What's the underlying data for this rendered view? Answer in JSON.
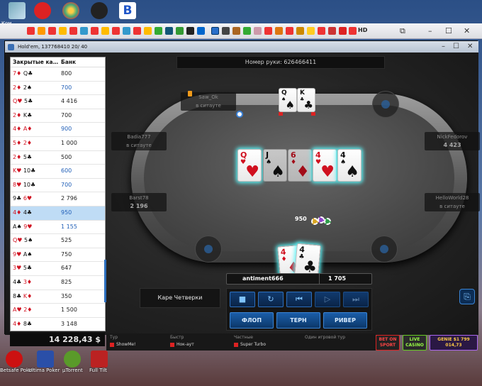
{
  "desktop": {
    "top_label": "Ком",
    "bottom_icons": [
      {
        "label": "Betsafe Poker"
      },
      {
        "label": "Ultima Poker"
      },
      {
        "label": "µTorrent"
      },
      {
        "label": "Full Tilt"
      }
    ]
  },
  "browser": {
    "hd_label": "HD"
  },
  "window": {
    "title": "Hold'em, 137768410  20/ 40"
  },
  "table": {
    "hand_number": "Номер руки: 626466411",
    "pot": "950",
    "board": [
      {
        "rank": "Q",
        "suit": "♥",
        "color": "red",
        "glow": true
      },
      {
        "rank": "J",
        "suit": "♠",
        "color": "black",
        "glow": false
      },
      {
        "rank": "6",
        "suit": "♦",
        "color": "red",
        "glow": false
      },
      {
        "rank": "4",
        "suit": "♥",
        "color": "red",
        "glow": true
      },
      {
        "rank": "4",
        "suit": "♠",
        "color": "black",
        "glow": true
      }
    ],
    "top_player_cards": [
      {
        "rank": "Q",
        "suit": "♠",
        "color": "black"
      },
      {
        "rank": "K",
        "suit": "♣",
        "color": "black"
      }
    ],
    "hero_cards": [
      {
        "rank": "4",
        "suit": "♦",
        "color": "red"
      },
      {
        "rank": "4",
        "suit": "♣",
        "color": "black"
      }
    ],
    "players": [
      {
        "name": "Saw_Ok",
        "status": "в ситауте"
      },
      {
        "name": "Badia777",
        "status": "в ситауте"
      },
      {
        "name": "NickFedorov",
        "stack": "4 423"
      },
      {
        "name": "Barst78",
        "stack": "2 196"
      },
      {
        "name": "HelloWorld28",
        "status": "в ситауте"
      }
    ],
    "hero": {
      "name": "antiment666",
      "stack": "1 705"
    },
    "hand_rank": "Каре Четверки"
  },
  "controls": {
    "icons": [
      "stop-icon",
      "refresh-icon",
      "skip-back-icon",
      "step-forward-icon",
      "skip-forward-icon"
    ],
    "flop": "ФЛОП",
    "turn": "ТЕРН",
    "river": "РИВЕР"
  },
  "history": {
    "col_hand": "Закрытые ка…",
    "col_pot": "Банк",
    "rows": [
      {
        "c1": "7",
        "s1": "♦",
        "c2": "Q",
        "s2": "♣",
        "pot": "800",
        "blue": false
      },
      {
        "c1": "2",
        "s1": "♦",
        "c2": "2",
        "s2": "♠",
        "pot": "700",
        "blue": true
      },
      {
        "c1": "Q",
        "s1": "♥",
        "c2": "5",
        "s2": "♣",
        "pot": "4 416",
        "blue": false
      },
      {
        "c1": "2",
        "s1": "♦",
        "c2": "K",
        "s2": "♣",
        "pot": "700",
        "blue": false
      },
      {
        "c1": "4",
        "s1": "♦",
        "c2": "A",
        "s2": "♦",
        "pot": "900",
        "blue": true
      },
      {
        "c1": "5",
        "s1": "♦",
        "c2": "2",
        "s2": "♦",
        "pot": "1 000",
        "blue": false
      },
      {
        "c1": "2",
        "s1": "♦",
        "c2": "5",
        "s2": "♣",
        "pot": "500",
        "blue": false
      },
      {
        "c1": "K",
        "s1": "♥",
        "c2": "10",
        "s2": "♣",
        "pot": "600",
        "blue": true
      },
      {
        "c1": "8",
        "s1": "♥",
        "c2": "10",
        "s2": "♣",
        "pot": "700",
        "blue": true
      },
      {
        "c1": "9",
        "s1": "♣",
        "c2": "6",
        "s2": "♥",
        "pot": "2 796",
        "blue": false
      },
      {
        "c1": "4",
        "s1": "♦",
        "c2": "4",
        "s2": "♣",
        "pot": "950",
        "blue": true,
        "selected": true
      },
      {
        "c1": "A",
        "s1": "♠",
        "c2": "9",
        "s2": "♥",
        "pot": "1 155",
        "blue": true
      },
      {
        "c1": "Q",
        "s1": "♥",
        "c2": "5",
        "s2": "♠",
        "pot": "525",
        "blue": false
      },
      {
        "c1": "9",
        "s1": "♥",
        "c2": "A",
        "s2": "♠",
        "pot": "750",
        "blue": false
      },
      {
        "c1": "3",
        "s1": "♥",
        "c2": "5",
        "s2": "♣",
        "pot": "647",
        "blue": false
      },
      {
        "c1": "4",
        "s1": "♣",
        "c2": "3",
        "s2": "♦",
        "pot": "825",
        "blue": false
      },
      {
        "c1": "8",
        "s1": "♣",
        "c2": "K",
        "s2": "♦",
        "pot": "350",
        "blue": false
      },
      {
        "c1": "A",
        "s1": "♥",
        "c2": "2",
        "s2": "♦",
        "pot": "1 500",
        "blue": false
      },
      {
        "c1": "4",
        "s1": "♦",
        "c2": "8",
        "s2": "♣",
        "pot": "3 148",
        "blue": false
      }
    ]
  },
  "balance": "14 228,43 $",
  "lobby": {
    "options": [
      "ShowMe!",
      "Нок-аут",
      "Super Turbo",
      "Тур",
      "Частные",
      "Быстр",
      "Один игровой тур"
    ],
    "promos": [
      {
        "label": "BET ON SPORT"
      },
      {
        "label": "LIVE CASINO"
      },
      {
        "label": "GENIE $1 799 014,73"
      }
    ]
  }
}
